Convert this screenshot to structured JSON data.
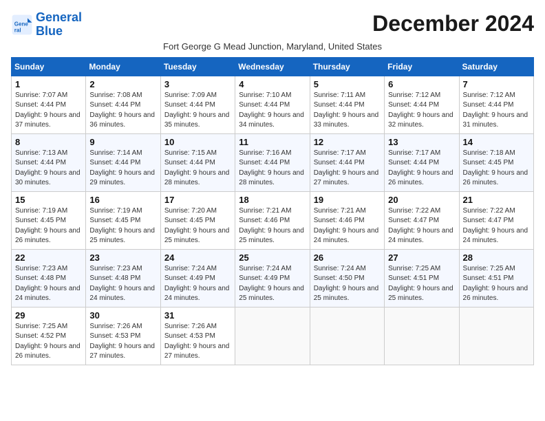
{
  "logo": {
    "line1": "General",
    "line2": "Blue"
  },
  "title": "December 2024",
  "location": "Fort George G Mead Junction, Maryland, United States",
  "days_of_week": [
    "Sunday",
    "Monday",
    "Tuesday",
    "Wednesday",
    "Thursday",
    "Friday",
    "Saturday"
  ],
  "weeks": [
    [
      {
        "day": "1",
        "sunrise": "7:07 AM",
        "sunset": "4:44 PM",
        "daylight": "9 hours and 37 minutes."
      },
      {
        "day": "2",
        "sunrise": "7:08 AM",
        "sunset": "4:44 PM",
        "daylight": "9 hours and 36 minutes."
      },
      {
        "day": "3",
        "sunrise": "7:09 AM",
        "sunset": "4:44 PM",
        "daylight": "9 hours and 35 minutes."
      },
      {
        "day": "4",
        "sunrise": "7:10 AM",
        "sunset": "4:44 PM",
        "daylight": "9 hours and 34 minutes."
      },
      {
        "day": "5",
        "sunrise": "7:11 AM",
        "sunset": "4:44 PM",
        "daylight": "9 hours and 33 minutes."
      },
      {
        "day": "6",
        "sunrise": "7:12 AM",
        "sunset": "4:44 PM",
        "daylight": "9 hours and 32 minutes."
      },
      {
        "day": "7",
        "sunrise": "7:12 AM",
        "sunset": "4:44 PM",
        "daylight": "9 hours and 31 minutes."
      }
    ],
    [
      {
        "day": "8",
        "sunrise": "7:13 AM",
        "sunset": "4:44 PM",
        "daylight": "9 hours and 30 minutes."
      },
      {
        "day": "9",
        "sunrise": "7:14 AM",
        "sunset": "4:44 PM",
        "daylight": "9 hours and 29 minutes."
      },
      {
        "day": "10",
        "sunrise": "7:15 AM",
        "sunset": "4:44 PM",
        "daylight": "9 hours and 28 minutes."
      },
      {
        "day": "11",
        "sunrise": "7:16 AM",
        "sunset": "4:44 PM",
        "daylight": "9 hours and 28 minutes."
      },
      {
        "day": "12",
        "sunrise": "7:17 AM",
        "sunset": "4:44 PM",
        "daylight": "9 hours and 27 minutes."
      },
      {
        "day": "13",
        "sunrise": "7:17 AM",
        "sunset": "4:44 PM",
        "daylight": "9 hours and 26 minutes."
      },
      {
        "day": "14",
        "sunrise": "7:18 AM",
        "sunset": "4:45 PM",
        "daylight": "9 hours and 26 minutes."
      }
    ],
    [
      {
        "day": "15",
        "sunrise": "7:19 AM",
        "sunset": "4:45 PM",
        "daylight": "9 hours and 26 minutes."
      },
      {
        "day": "16",
        "sunrise": "7:19 AM",
        "sunset": "4:45 PM",
        "daylight": "9 hours and 25 minutes."
      },
      {
        "day": "17",
        "sunrise": "7:20 AM",
        "sunset": "4:45 PM",
        "daylight": "9 hours and 25 minutes."
      },
      {
        "day": "18",
        "sunrise": "7:21 AM",
        "sunset": "4:46 PM",
        "daylight": "9 hours and 25 minutes."
      },
      {
        "day": "19",
        "sunrise": "7:21 AM",
        "sunset": "4:46 PM",
        "daylight": "9 hours and 24 minutes."
      },
      {
        "day": "20",
        "sunrise": "7:22 AM",
        "sunset": "4:47 PM",
        "daylight": "9 hours and 24 minutes."
      },
      {
        "day": "21",
        "sunrise": "7:22 AM",
        "sunset": "4:47 PM",
        "daylight": "9 hours and 24 minutes."
      }
    ],
    [
      {
        "day": "22",
        "sunrise": "7:23 AM",
        "sunset": "4:48 PM",
        "daylight": "9 hours and 24 minutes."
      },
      {
        "day": "23",
        "sunrise": "7:23 AM",
        "sunset": "4:48 PM",
        "daylight": "9 hours and 24 minutes."
      },
      {
        "day": "24",
        "sunrise": "7:24 AM",
        "sunset": "4:49 PM",
        "daylight": "9 hours and 24 minutes."
      },
      {
        "day": "25",
        "sunrise": "7:24 AM",
        "sunset": "4:49 PM",
        "daylight": "9 hours and 25 minutes."
      },
      {
        "day": "26",
        "sunrise": "7:24 AM",
        "sunset": "4:50 PM",
        "daylight": "9 hours and 25 minutes."
      },
      {
        "day": "27",
        "sunrise": "7:25 AM",
        "sunset": "4:51 PM",
        "daylight": "9 hours and 25 minutes."
      },
      {
        "day": "28",
        "sunrise": "7:25 AM",
        "sunset": "4:51 PM",
        "daylight": "9 hours and 26 minutes."
      }
    ],
    [
      {
        "day": "29",
        "sunrise": "7:25 AM",
        "sunset": "4:52 PM",
        "daylight": "9 hours and 26 minutes."
      },
      {
        "day": "30",
        "sunrise": "7:26 AM",
        "sunset": "4:53 PM",
        "daylight": "9 hours and 27 minutes."
      },
      {
        "day": "31",
        "sunrise": "7:26 AM",
        "sunset": "4:53 PM",
        "daylight": "9 hours and 27 minutes."
      },
      null,
      null,
      null,
      null
    ]
  ]
}
